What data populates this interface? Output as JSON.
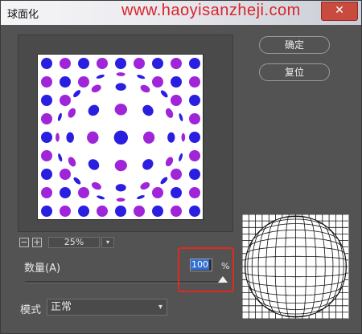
{
  "window": {
    "title": "球面化",
    "watermark": "www.haoyisanzheji.com",
    "close_glyph": "✕"
  },
  "buttons": {
    "ok_label": "确定",
    "reset_label": "复位"
  },
  "zoom": {
    "minus": "−",
    "plus": "+",
    "value": "25%",
    "chevron": "▾"
  },
  "amount": {
    "label": "数量(A)",
    "value": "100",
    "unit": "%",
    "slider_fraction": 1.0
  },
  "mode": {
    "label": "模式",
    "selected": "正常",
    "chevron": "▾"
  },
  "colors": {
    "dot_blue": "#2a1fe0",
    "dot_purple": "#a025d8",
    "highlight": "#e02a1f",
    "close": "#c94a3e"
  },
  "icons": {
    "close": "close-icon",
    "zoom_out": "minus-icon",
    "zoom_in": "plus-icon",
    "dropdown": "chevron-down-icon"
  }
}
